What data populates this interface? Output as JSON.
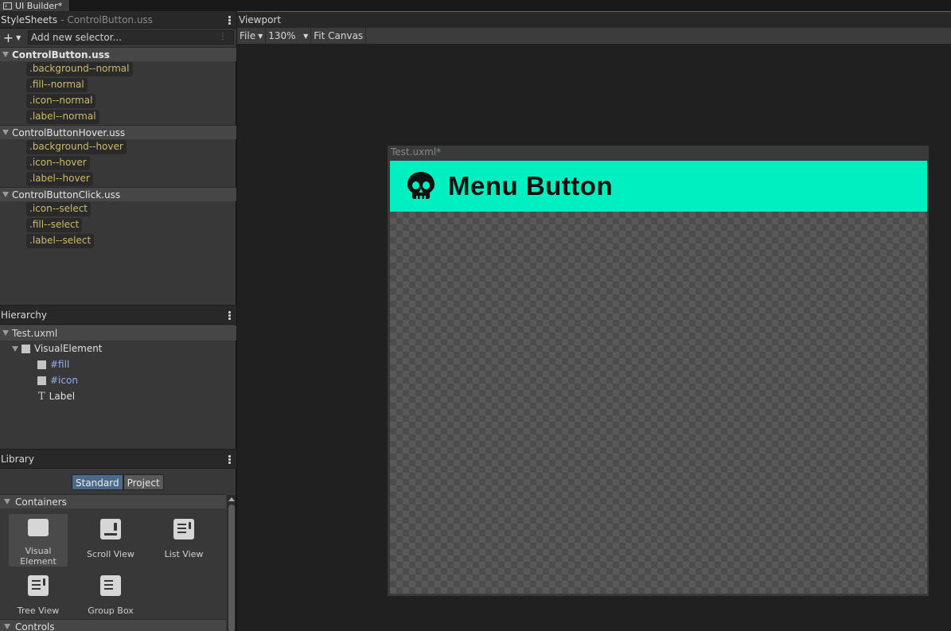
{
  "window": {
    "tab_title": "UI Builder*",
    "tab_icon": "ui-builder-icon"
  },
  "stylesheets": {
    "title": "StyleSheets",
    "separator": "-",
    "active_file": "ControlButton.uss",
    "add_label": "+",
    "selector_placeholder": "Add new selector...",
    "files": [
      {
        "name": "ControlButton.uss",
        "selectors": [
          ".background--normal",
          ".fill--normal",
          ".icon--normal",
          ".label--normal"
        ]
      },
      {
        "name": "ControlButtonHover.uss",
        "selectors": [
          ".background--hover",
          ".icon--hover",
          ".label--hover"
        ]
      },
      {
        "name": "ControlButtonClick.uss",
        "selectors": [
          ".icon--select",
          ".fill--select",
          ".label--select"
        ]
      }
    ]
  },
  "hierarchy": {
    "title": "Hierarchy",
    "root": "Test.uxml",
    "items": [
      {
        "name": "VisualElement",
        "type": "visual-element"
      },
      {
        "name": "#fill",
        "type": "named"
      },
      {
        "name": "#icon",
        "type": "named"
      },
      {
        "name": "Label",
        "type": "text"
      }
    ]
  },
  "library": {
    "title": "Library",
    "tabs": [
      "Standard",
      "Project"
    ],
    "active_tab": "Standard",
    "sections": [
      "Containers",
      "Controls"
    ],
    "containers": [
      "Visual\nElement",
      "Scroll View",
      "List View",
      "Tree View",
      "Group Box"
    ]
  },
  "viewport": {
    "title": "Viewport",
    "file_menu": "File",
    "zoom": "130%",
    "fit_canvas": "Fit Canvas",
    "canvas_title": "Test.uxml*",
    "button_label": "Menu Button",
    "button_color": "#00efc0",
    "button_icon": "skull-icon"
  },
  "colors": {
    "accent_blue": "#3d6aa6",
    "selector_text": "#cdbb6a",
    "named_element_text": "#8fb1f0"
  }
}
